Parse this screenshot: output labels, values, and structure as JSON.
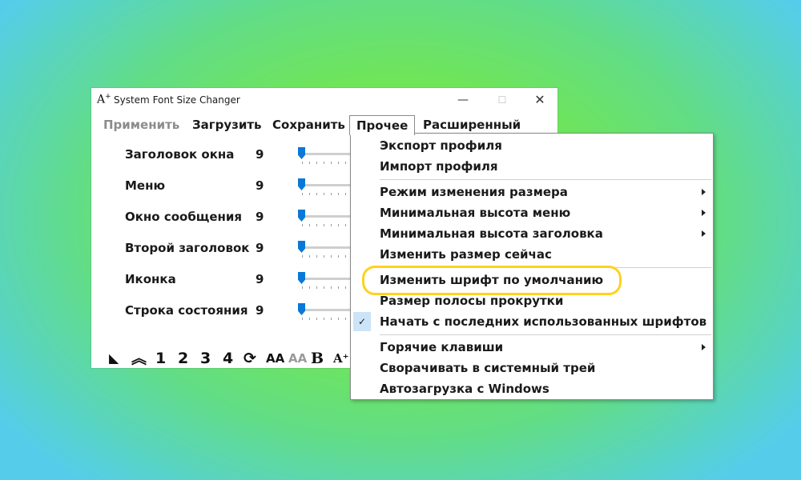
{
  "window": {
    "title": "System Font Size Changer",
    "app_icon_text": "A",
    "app_icon_plus": "+",
    "minimize_glyph": "—",
    "maximize_glyph": "☐",
    "close_glyph": "✕"
  },
  "menubar": {
    "apply": "Применить",
    "load": "Загрузить",
    "save": "Сохранить",
    "other": "Прочее",
    "advanced": "Расширенный"
  },
  "rows": [
    {
      "label": "Заголовок окна",
      "value": "9"
    },
    {
      "label": "Меню",
      "value": "9"
    },
    {
      "label": "Окно сообщения",
      "value": "9"
    },
    {
      "label": "Второй заголовок",
      "value": "9"
    },
    {
      "label": "Иконка",
      "value": "9"
    },
    {
      "label": "Строка состояния",
      "value": "9"
    }
  ],
  "toolbar": {
    "t1": "1",
    "t2": "2",
    "t3": "3",
    "t4": "4",
    "refresh": "⟳",
    "aa_dark": "AA",
    "aa_light": "AA",
    "bold": "B",
    "a_plus": "A⁺",
    "chevron": "︽",
    "corner": "◣"
  },
  "dropdown": {
    "items": [
      {
        "label": "Экспорт профиля"
      },
      {
        "label": "Импорт профиля"
      },
      {
        "label": "Режим изменения размера"
      },
      {
        "label": "Минимальная высота меню"
      },
      {
        "label": "Минимальная высота заголовка"
      },
      {
        "label": "Изменить размер сейчас"
      },
      {
        "label": "Изменить шрифт по умолчанию"
      },
      {
        "label": "Размер полосы прокрутки"
      },
      {
        "label": "Начать с последних использованных шрифтов"
      },
      {
        "label": "Горячие клавиши"
      },
      {
        "label": "Сворачивать в системный трей"
      },
      {
        "label": "Автозагрузка с Windows"
      }
    ],
    "check_glyph": "✓"
  },
  "colors": {
    "accent": "#0a78d7",
    "highlight_ring": "#ffd21c",
    "checked_bg": "#cce4f7"
  }
}
